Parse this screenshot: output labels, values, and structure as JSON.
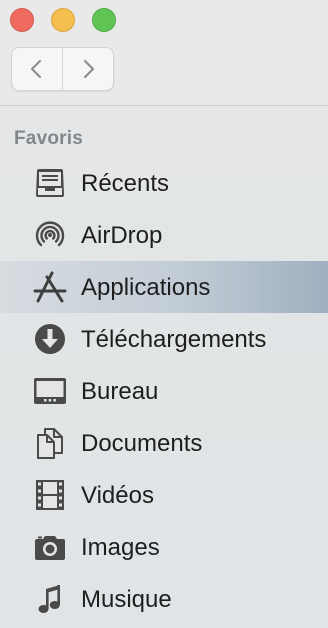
{
  "window": {
    "traffic_lights": {
      "close": "#ee6a5f",
      "minimize": "#f5be4f",
      "maximize": "#61c554"
    },
    "nav": {
      "back_icon": "chevron-left-icon",
      "forward_icon": "chevron-right-icon"
    }
  },
  "sidebar": {
    "section_title": "Favoris",
    "items": [
      {
        "label": "Récents",
        "icon": "recents-icon",
        "selected": false
      },
      {
        "label": "AirDrop",
        "icon": "airdrop-icon",
        "selected": false
      },
      {
        "label": "Applications",
        "icon": "applications-icon",
        "selected": true
      },
      {
        "label": "Téléchargements",
        "icon": "downloads-icon",
        "selected": false
      },
      {
        "label": "Bureau",
        "icon": "desktop-icon",
        "selected": false
      },
      {
        "label": "Documents",
        "icon": "documents-icon",
        "selected": false
      },
      {
        "label": "Vidéos",
        "icon": "movies-icon",
        "selected": false
      },
      {
        "label": "Images",
        "icon": "camera-icon",
        "selected": false
      },
      {
        "label": "Musique",
        "icon": "music-note-icon",
        "selected": false
      }
    ]
  }
}
